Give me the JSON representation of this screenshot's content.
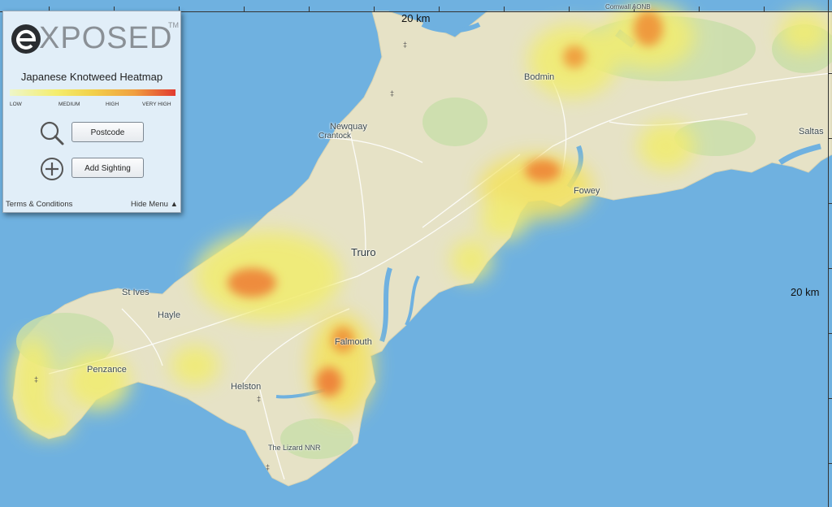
{
  "panel": {
    "logo_text": "XPOSED",
    "logo_tm": "TM",
    "title": "Japanese Knotweed Heatmap",
    "legend": [
      "LOW",
      "MEDIUM",
      "HIGH",
      "VERY HIGH"
    ],
    "postcode_label": "Postcode",
    "add_sighting_label": "Add Sighting",
    "terms_label": "Terms & Conditions",
    "hide_menu_label": "Hide Menu ▲"
  },
  "map": {
    "scale_label": "20 km",
    "places": {
      "cornwall_aonb": "Cornwall AONB",
      "bodmin": "Bodmin",
      "newquay": "Newquay",
      "crantock": "Crantock",
      "fowey": "Fowey",
      "saltash": "Saltas",
      "truro": "Truro",
      "st_ives": "St Ives",
      "hayle": "Hayle",
      "falmouth": "Falmouth",
      "penzance": "Penzance",
      "helston": "Helston",
      "the_lizard": "The Lizard NNR"
    },
    "colors": {
      "sea": "#6fb1e0",
      "land": "#e6e2c6",
      "green": "#c3daa1"
    }
  }
}
